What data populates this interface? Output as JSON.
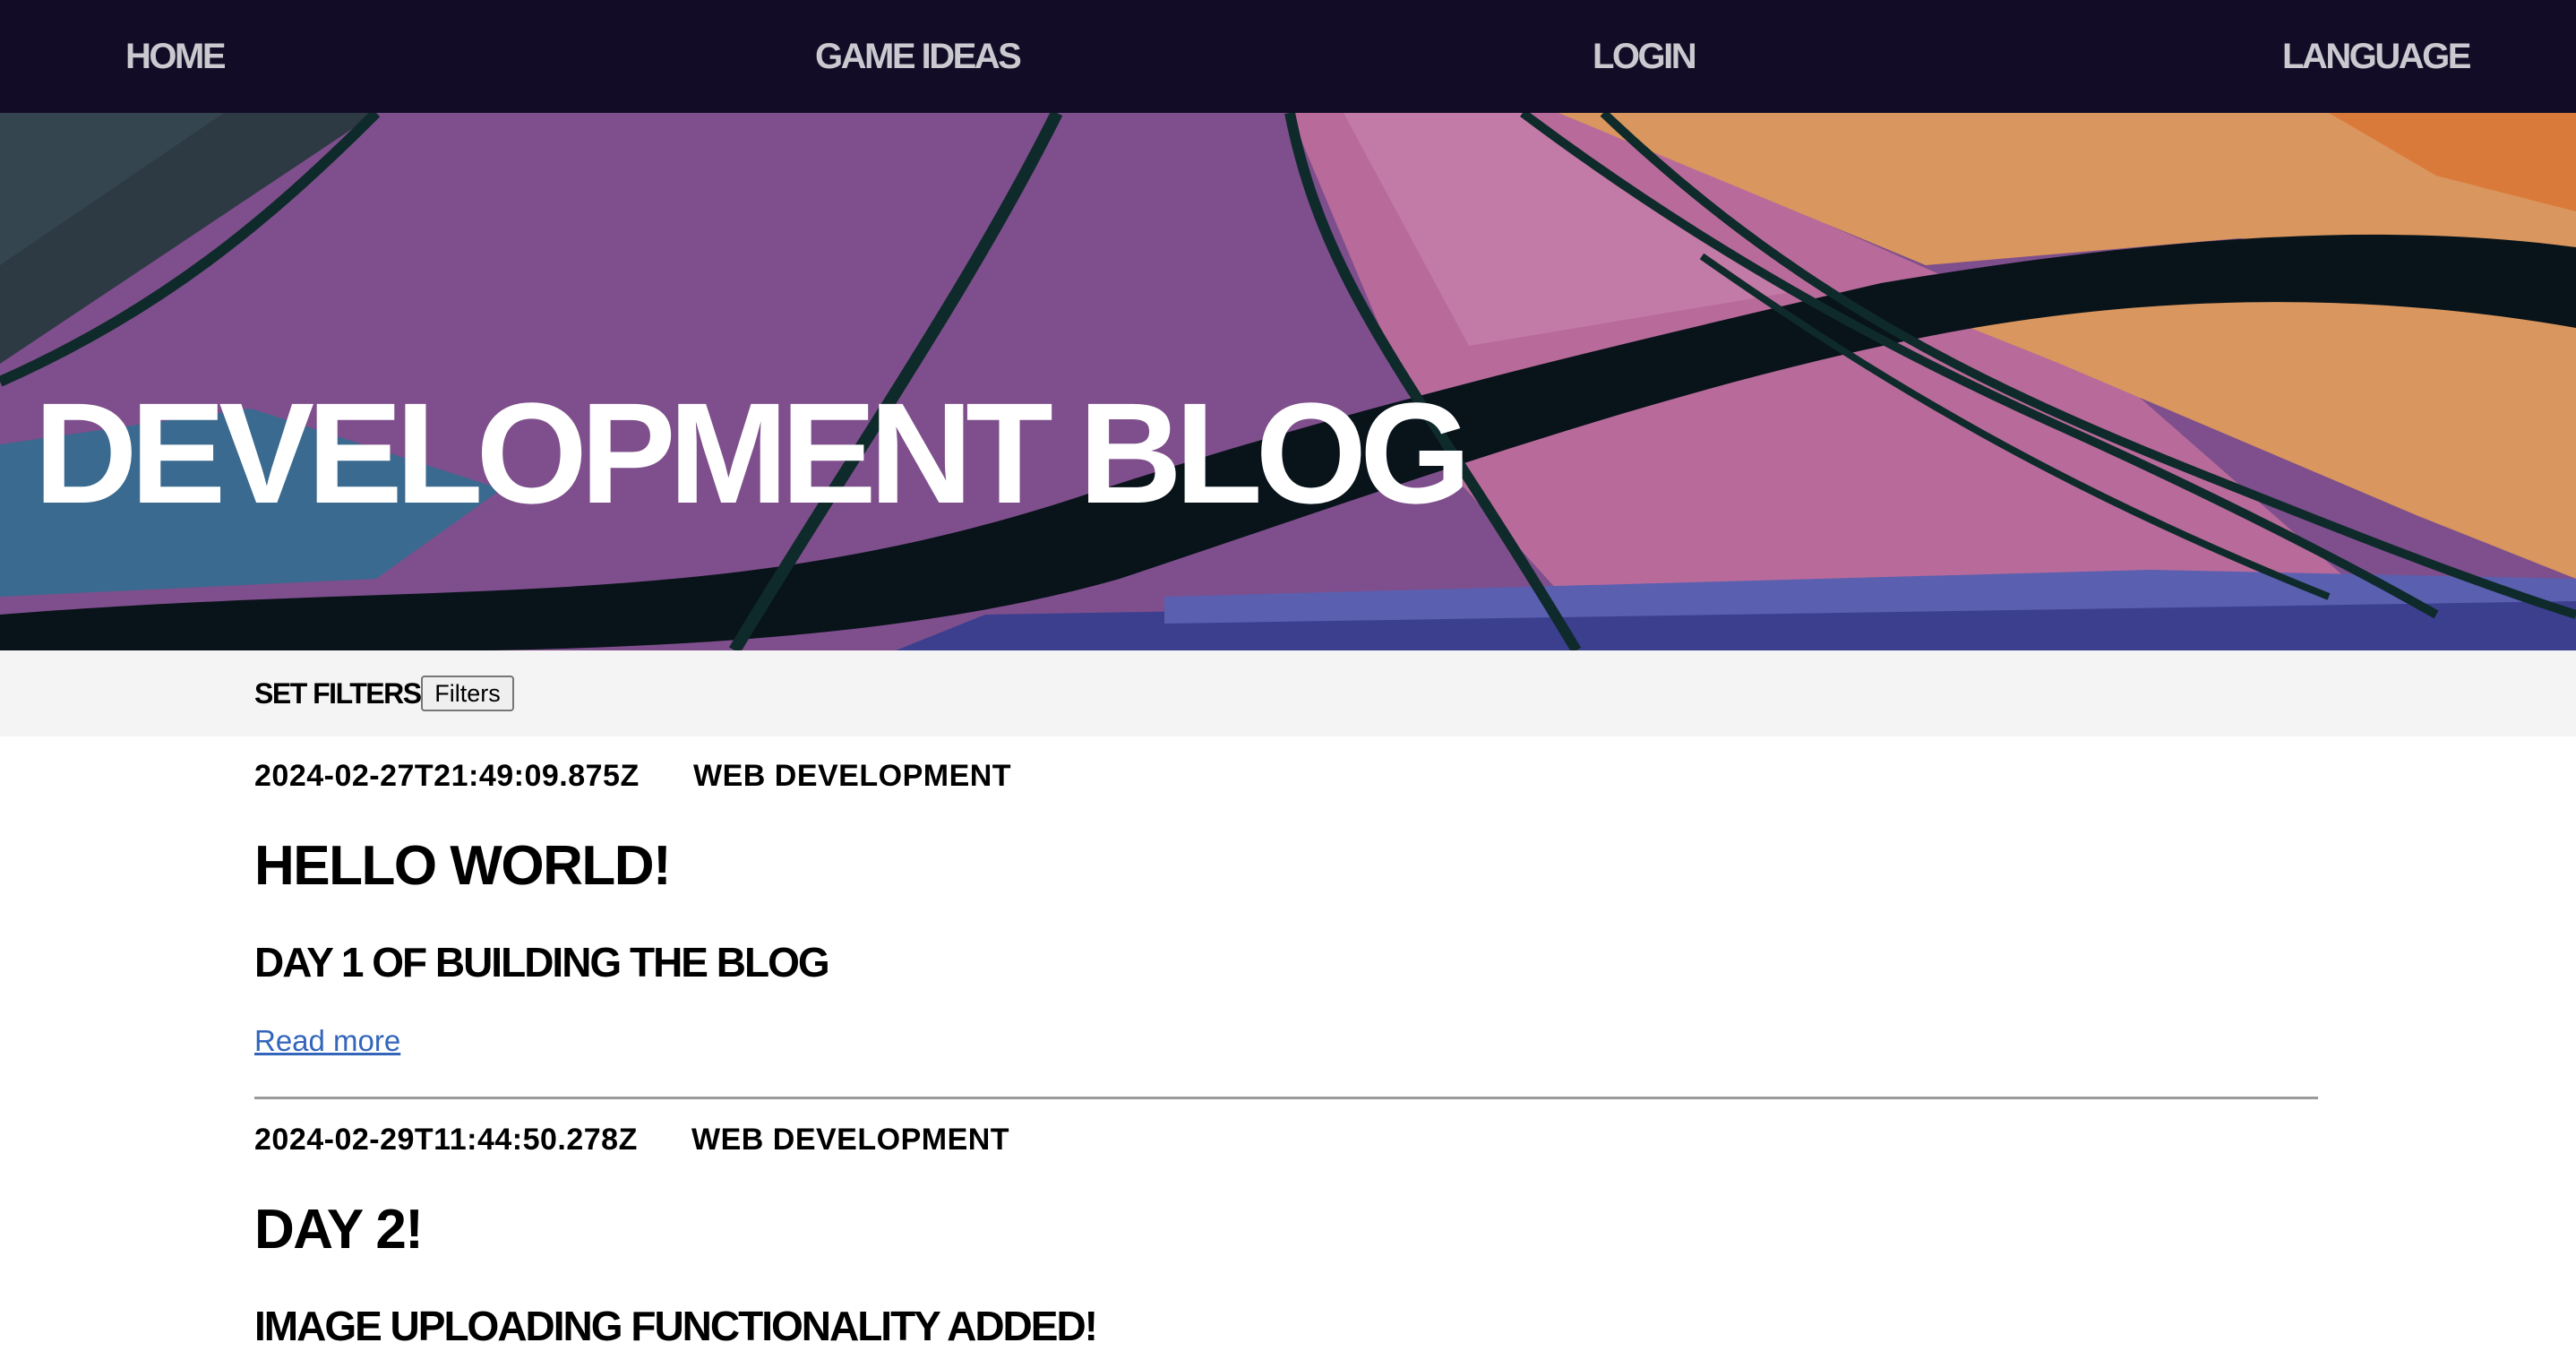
{
  "nav": {
    "home": "HOME",
    "game_ideas": "GAME IDEAS",
    "login": "LOGIN",
    "language": "LANGUAGE"
  },
  "hero": {
    "title": "DEVELOPMENT BLOG"
  },
  "filters": {
    "label": "SET FILTERS :",
    "button": "Filters"
  },
  "posts": [
    {
      "timestamp": "2024-02-27T21:49:09.875Z",
      "category": "WEB DEVELOPMENT",
      "title": "HELLO WORLD!",
      "subtitle": "DAY 1 OF BUILDING THE BLOG",
      "read_more": "Read more"
    },
    {
      "timestamp": "2024-02-29T11:44:50.278Z",
      "category": "WEB DEVELOPMENT",
      "title": "DAY 2!",
      "subtitle": "IMAGE UPLOADING FUNCTIONALITY ADDED!"
    }
  ],
  "colors": {
    "nav_bg": "#120c26",
    "nav_text": "#c9c9cf",
    "hero_purple": "#7e4f8c",
    "hero_pink": "#b86b9a",
    "hero_orange": "#d9965e",
    "hero_blue": "#3a6a8f",
    "hero_dark": "#08131a",
    "link": "#3366bb",
    "filter_bg": "#f4f4f4"
  }
}
